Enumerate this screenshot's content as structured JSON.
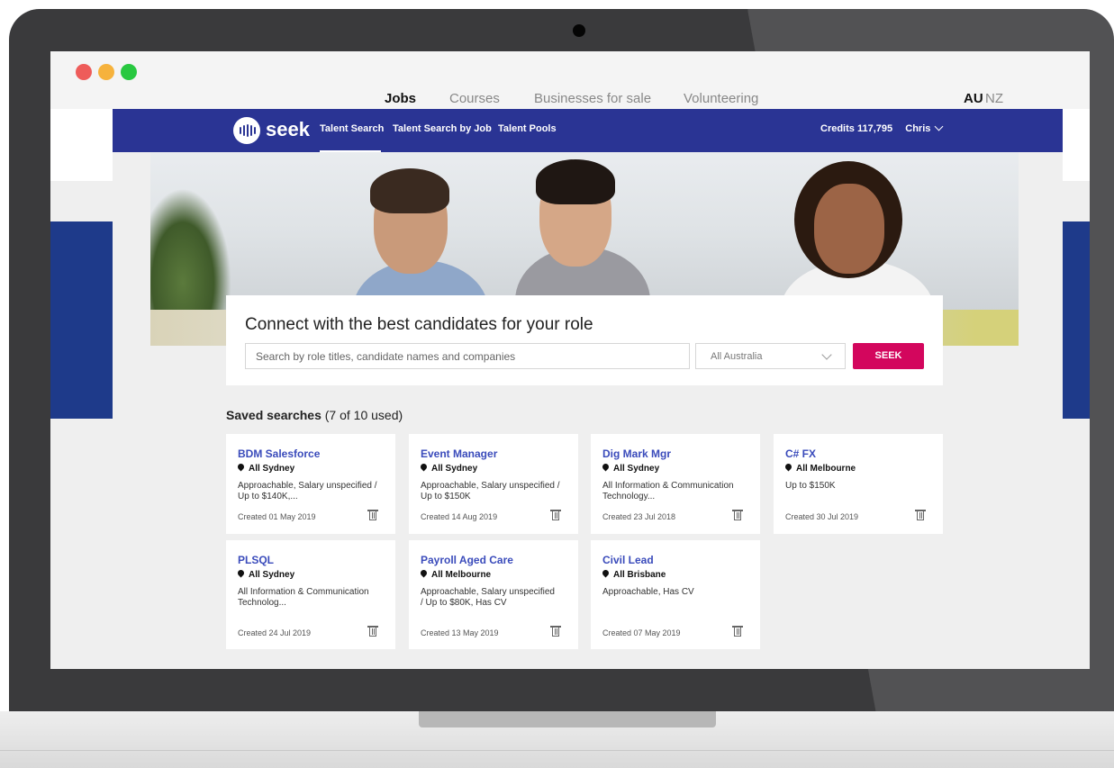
{
  "browser": {
    "traffic_lights": [
      "close",
      "minimize",
      "maximize"
    ]
  },
  "site_nav": {
    "items": [
      {
        "label": "Jobs",
        "active": true
      },
      {
        "label": "Courses",
        "active": false
      },
      {
        "label": "Businesses for sale",
        "active": false
      },
      {
        "label": "Volunteering",
        "active": false
      }
    ],
    "regions": [
      {
        "label": "AU",
        "active": true
      },
      {
        "label": "NZ",
        "active": false
      }
    ]
  },
  "seek_header": {
    "logo_text": "seek",
    "tabs": [
      "Talent Search",
      "Talent Search by Job",
      "Talent Pools"
    ],
    "active_tab": "Talent Search",
    "credits_label": "Credits",
    "credits_value": "117,795",
    "user_name": "Chris",
    "brand_color": "#2a3494"
  },
  "search": {
    "heading": "Connect with the best candidates for your role",
    "placeholder": "Search by role titles, candidate names and companies",
    "location": "All Australia",
    "button": "SEEK",
    "button_color": "#d3065d"
  },
  "saved": {
    "title": "Saved searches",
    "usage": "(7 of 10 used)",
    "cards": [
      {
        "title": "BDM Salesforce",
        "location": "All Sydney",
        "desc": "Approachable, Salary unspecified / Up to $140K,...",
        "created": "Created 01 May 2019"
      },
      {
        "title": "Event Manager",
        "location": "All Sydney",
        "desc": "Approachable, Salary unspecified / Up to $150K",
        "created": "Created 14 Aug 2019"
      },
      {
        "title": "Dig Mark Mgr",
        "location": "All Sydney",
        "desc": "All Information & Communication Technology...",
        "created": "Created 23 Jul 2018"
      },
      {
        "title": "C# FX",
        "location": "All Melbourne",
        "desc": "Up to $150K",
        "created": "Created 30 Jul 2019"
      },
      {
        "title": "PLSQL",
        "location": "All Sydney",
        "desc": "All Information & Communication Technolog...",
        "created": "Created 24 Jul 2019"
      },
      {
        "title": "Payroll Aged Care",
        "location": "All Melbourne",
        "desc": "Approachable, Salary unspecified / Up to $80K, Has CV",
        "created": "Created 13 May 2019"
      },
      {
        "title": "Civil Lead",
        "location": "All Brisbane",
        "desc": "Approachable, Has CV",
        "created": "Created 07 May 2019"
      }
    ]
  }
}
